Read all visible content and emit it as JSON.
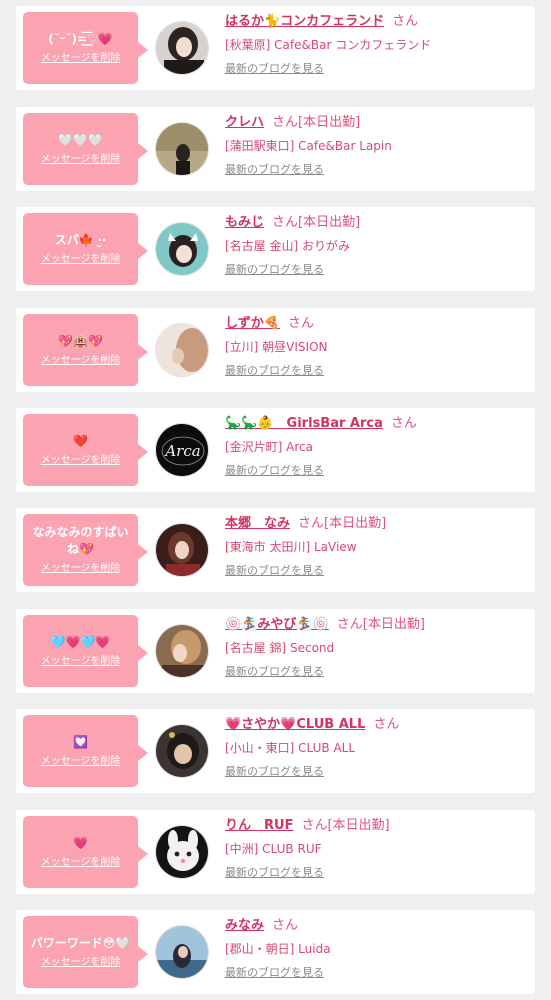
{
  "colors": {
    "accent": "#d4335f",
    "bubble": "#fba3b1",
    "background": "#efeff0",
    "link_gray": "#8a8a8a"
  },
  "entries": [
    {
      "message": "(˘ᵕ˘)=͟͟͞♡💗",
      "delete_label": "メッセージを削除",
      "name": "はるか🐈コンカフェランド",
      "honorific": "さん",
      "status": "",
      "shop": "[秋葉原] Cafe&Bar コンカフェランド",
      "blog_label": "最新のブログを見る"
    },
    {
      "message": "🤍🤍🤍",
      "delete_label": "メッセージを削除",
      "name": "クレハ",
      "honorific": "さん",
      "status": "[本日出勤]",
      "shop": "[蒲田駅東口] Cafe&Bar Lapin",
      "blog_label": "最新のブログを見る"
    },
    {
      "message": "スパ🍁 ‧̫‧",
      "delete_label": "メッセージを削除",
      "name": "もみじ",
      "honorific": "さん",
      "status": "[本日出勤]",
      "shop": "[名古屋 金山] おりがみ",
      "blog_label": "最新のブログを見る"
    },
    {
      "message": "💖🏨💖",
      "delete_label": "メッセージを削除",
      "name": "しずか🍕",
      "honorific": "さん",
      "status": "",
      "shop": "[立川] 朝昼VISION",
      "blog_label": "最新のブログを見る"
    },
    {
      "message": "❤️",
      "delete_label": "メッセージを削除",
      "name": "🦕🦕👶　GirlsBar Arca",
      "honorific": "さん",
      "status": "",
      "shop": "[金沢片町] Arca",
      "blog_label": "最新のブログを見る"
    },
    {
      "message": "なみなみのすばいね💖",
      "delete_label": "メッセージを削除",
      "name": "本郷　なみ",
      "honorific": "さん",
      "status": "[本日出勤]",
      "shop": "[東海市 太田川] LaView",
      "blog_label": "最新のブログを見る"
    },
    {
      "message": "🩵💗🩵💗",
      "delete_label": "メッセージを削除",
      "name": "🍥🏂みやび🏂🍥",
      "honorific": "さん",
      "status": "[本日出勤]",
      "shop": "[名古屋 錦] Second",
      "blog_label": "最新のブログを見る"
    },
    {
      "message": "💟",
      "delete_label": "メッセージを削除",
      "name": "💗さやか💗CLUB ALL",
      "honorific": "さん",
      "status": "",
      "shop": "[小山・東口] CLUB ALL",
      "blog_label": "最新のブログを見る"
    },
    {
      "message": "💗",
      "delete_label": "メッセージを削除",
      "name": "りん　RUF",
      "honorific": "さん",
      "status": "[本日出勤]",
      "shop": "[中洲] CLUB RUF",
      "blog_label": "最新のブログを見る"
    },
    {
      "message": "パワーワード😳🤍",
      "delete_label": "メッセージを削除",
      "name": "みなみ",
      "honorific": "さん",
      "status": "",
      "shop": "[郡山・朝日] Luida",
      "blog_label": "最新のブログを見る"
    }
  ]
}
